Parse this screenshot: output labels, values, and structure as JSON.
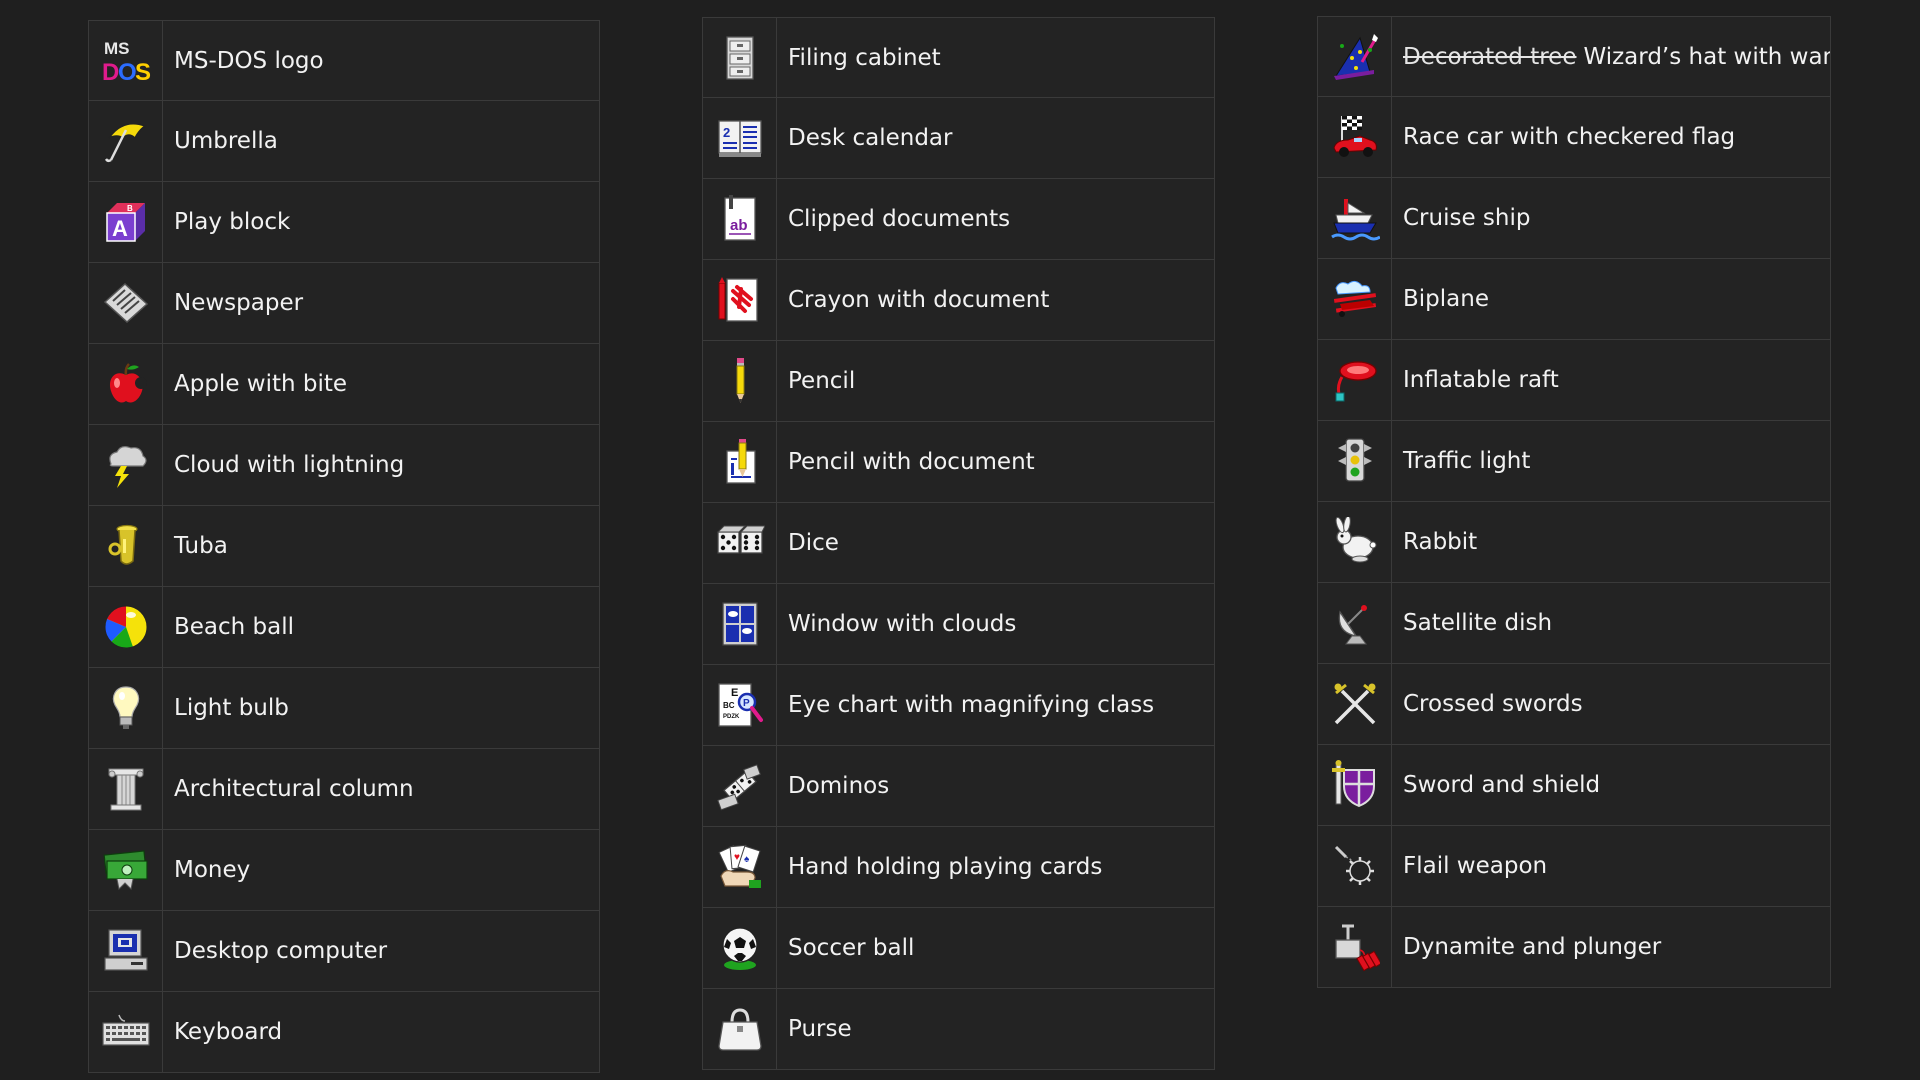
{
  "columns": [
    {
      "items": [
        {
          "icon": "msdos-logo-icon",
          "label": "MS-DOS logo"
        },
        {
          "icon": "umbrella-icon",
          "label": "Umbrella"
        },
        {
          "icon": "play-block-icon",
          "label": "Play block"
        },
        {
          "icon": "newspaper-icon",
          "label": "Newspaper"
        },
        {
          "icon": "apple-icon",
          "label": "Apple with bite"
        },
        {
          "icon": "cloud-lightning-icon",
          "label": "Cloud with lightning"
        },
        {
          "icon": "tuba-icon",
          "label": "Tuba"
        },
        {
          "icon": "beach-ball-icon",
          "label": "Beach ball"
        },
        {
          "icon": "light-bulb-icon",
          "label": "Light bulb"
        },
        {
          "icon": "column-icon",
          "label": "Architectural column"
        },
        {
          "icon": "money-icon",
          "label": "Money"
        },
        {
          "icon": "desktop-computer-icon",
          "label": "Desktop computer"
        },
        {
          "icon": "keyboard-icon",
          "label": "Keyboard"
        }
      ]
    },
    {
      "items": [
        {
          "icon": "filing-cabinet-icon",
          "label": "Filing cabinet"
        },
        {
          "icon": "desk-calendar-icon",
          "label": "Desk calendar"
        },
        {
          "icon": "clipped-documents-icon",
          "label": "Clipped documents"
        },
        {
          "icon": "crayon-document-icon",
          "label": "Crayon with document"
        },
        {
          "icon": "pencil-icon",
          "label": "Pencil"
        },
        {
          "icon": "pencil-document-icon",
          "label": "Pencil with document"
        },
        {
          "icon": "dice-icon",
          "label": "Dice"
        },
        {
          "icon": "window-clouds-icon",
          "label": "Window with clouds"
        },
        {
          "icon": "eye-chart-icon",
          "label": "Eye chart with magnifying class"
        },
        {
          "icon": "dominos-icon",
          "label": "Dominos"
        },
        {
          "icon": "playing-cards-icon",
          "label": "Hand holding playing cards"
        },
        {
          "icon": "soccer-ball-icon",
          "label": "Soccer ball"
        },
        {
          "icon": "purse-icon",
          "label": "Purse"
        }
      ]
    },
    {
      "items": [
        {
          "icon": "wizard-hat-icon",
          "struck": "Decorated tree",
          "label": "Wizard’s hat with wand"
        },
        {
          "icon": "race-car-icon",
          "label": "Race car with checkered flag"
        },
        {
          "icon": "cruise-ship-icon",
          "label": "Cruise ship"
        },
        {
          "icon": "biplane-icon",
          "label": "Biplane"
        },
        {
          "icon": "inflatable-raft-icon",
          "label": "Inflatable raft"
        },
        {
          "icon": "traffic-light-icon",
          "label": "Traffic light"
        },
        {
          "icon": "rabbit-icon",
          "label": "Rabbit"
        },
        {
          "icon": "satellite-dish-icon",
          "label": "Satellite dish"
        },
        {
          "icon": "crossed-swords-icon",
          "label": "Crossed swords"
        },
        {
          "icon": "sword-shield-icon",
          "label": "Sword and shield"
        },
        {
          "icon": "flail-icon",
          "label": "Flail weapon"
        },
        {
          "icon": "dynamite-icon",
          "label": "Dynamite and plunger"
        }
      ]
    }
  ]
}
